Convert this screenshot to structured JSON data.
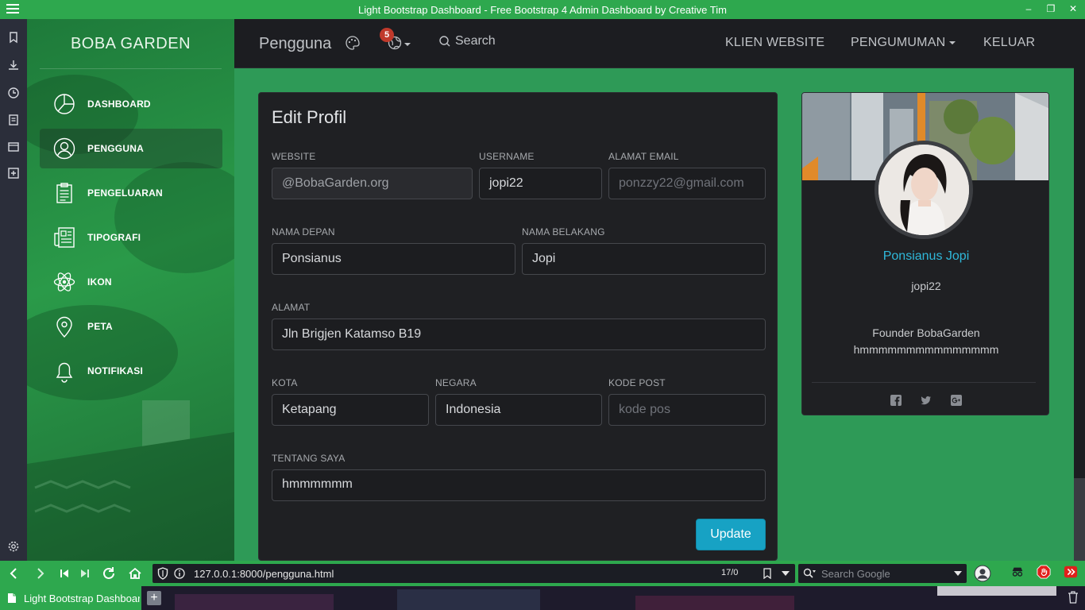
{
  "browser": {
    "window_title": "Light Bootstrap Dashboard - Free Bootstrap 4 Admin Dashboard by Creative Tim",
    "url": "127.0.0.1:8000/pengguna.html",
    "page_counter": "17/0",
    "search_placeholder": "Search Google",
    "tab_title": "Light Bootstrap Dashboard",
    "accent_color": "#2ea84e"
  },
  "sidebar": {
    "brand": "BOBA GARDEN",
    "items": [
      {
        "label": "DASHBOARD",
        "icon": "pie-chart-icon",
        "active": false
      },
      {
        "label": "PENGGUNA",
        "icon": "user-circle-icon",
        "active": true
      },
      {
        "label": "PENGELUARAN",
        "icon": "clipboard-icon",
        "active": false
      },
      {
        "label": "TIPOGRAFI",
        "icon": "newspaper-icon",
        "active": false
      },
      {
        "label": "IKON",
        "icon": "atom-icon",
        "active": false
      },
      {
        "label": "PETA",
        "icon": "map-pin-icon",
        "active": false
      },
      {
        "label": "NOTIFIKASI",
        "icon": "bell-icon",
        "active": false
      }
    ]
  },
  "navbar": {
    "page_title": "Pengguna",
    "notification_count": "5",
    "search_label": "Search",
    "links": [
      "KLIEN WEBSITE",
      "PENGUMUMAN",
      "KELUAR"
    ]
  },
  "form": {
    "title": "Edit Profil",
    "website_label": "WEBSITE",
    "website_value": "@BobaGarden.org",
    "username_label": "USERNAME",
    "username_value": "jopi22",
    "email_label": "ALAMAT EMAIL",
    "email_placeholder": "ponzzy22@gmail.com",
    "first_name_label": "NAMA DEPAN",
    "first_name_value": "Ponsianus",
    "last_name_label": "NAMA BELAKANG",
    "last_name_value": "Jopi",
    "address_label": "ALAMAT",
    "address_value": "Jln Brigjen Katamso B19",
    "city_label": "KOTA",
    "city_value": "Ketapang",
    "country_label": "NEGARA",
    "country_value": "Indonesia",
    "postal_label": "KODE POST",
    "postal_placeholder": "kode pos",
    "about_label": "TENTANG SAYA",
    "about_value": "hmmmmmm",
    "submit_label": "Update"
  },
  "profile_card": {
    "name": "Ponsianus Jopi",
    "username": "jopi22",
    "bio_line1": "Founder BobaGarden",
    "bio_line2": "hmmmmmmmmmmmmmmm",
    "social_icons": [
      "facebook-icon",
      "twitter-icon",
      "google-plus-icon"
    ],
    "name_color": "#2fb8da"
  },
  "colors": {
    "content_bg": "#2e9a57",
    "card_bg": "#1f2023",
    "button": "#17a2c4",
    "badge": "#c0392b"
  }
}
